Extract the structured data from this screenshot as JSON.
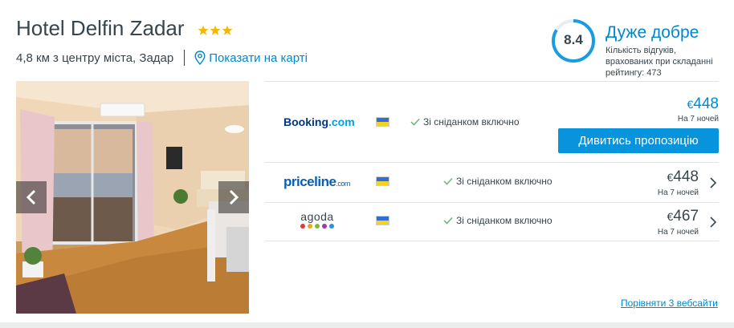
{
  "hotel": {
    "name": "Hotel Delfin Zadar",
    "stars": 3,
    "distance": "4,8 км з центру міста, Задар",
    "map_link": "Показати на карті"
  },
  "rating": {
    "score": "8.4",
    "score_fraction": 0.84,
    "label": "Дуже добре",
    "note": "Кількість відгуків, врахованих при складанні рейтингу: 473"
  },
  "deals": [
    {
      "provider": "Booking.com",
      "provider_main": "Booking",
      "provider_suffix": ".com",
      "flag": "ukraine-flag",
      "offer": "Зі сніданком включно",
      "currency": "€",
      "price": "448",
      "nights": "На 7 ночей",
      "button": "Дивитись пропозицію"
    },
    {
      "provider": "priceline.com",
      "provider_main": "priceline",
      "provider_suffix": ".com",
      "flag": "ukraine-flag",
      "offer": "Зі сніданком включно",
      "currency": "€",
      "price": "448",
      "nights": "На 7 ночей"
    },
    {
      "provider": "agoda",
      "provider_main": "agoda",
      "flag": "ukraine-flag",
      "offer": "Зі сніданком включно",
      "currency": "€",
      "price": "467",
      "nights": "На 7 ночей",
      "dot_colors": [
        "#e4383c",
        "#f3a51d",
        "#7eba3a",
        "#9b3aa5",
        "#2f8fd8"
      ]
    }
  ],
  "compare_link": "Порівняти 3 вебсайти",
  "colors": {
    "accent": "#0088cc",
    "button": "#0894dd",
    "rating_ring": "#1a9ce0",
    "star": "#f5b800",
    "text": "#37454d"
  },
  "icons": {
    "star": "star-icon",
    "map_pin": "map-pin-icon",
    "check": "check-icon",
    "chevron": "chevron-right-icon",
    "prev": "chevron-left-icon",
    "next": "chevron-right-icon"
  }
}
